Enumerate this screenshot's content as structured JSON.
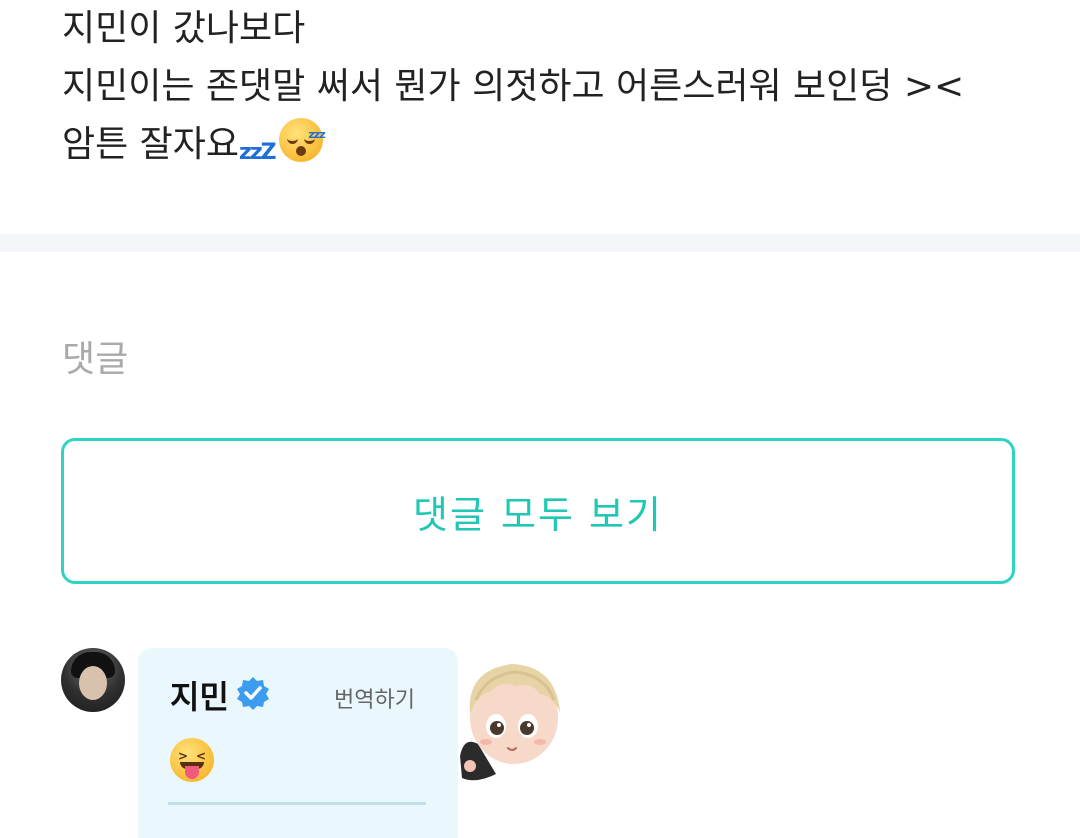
{
  "post": {
    "lines": [
      "지민이 갔나보다",
      "지민이는 존댓말 써서 뭔가 의젓하고 어른스러워 보인덩 ><",
      "암튼 잘자요"
    ],
    "emoji_zzz": "💤",
    "emoji_sleepy": "😴"
  },
  "comments": {
    "heading": "댓글",
    "view_all_label": "댓글 모두 보기",
    "items": [
      {
        "author": "지민",
        "translate_label": "번역하기",
        "emoji": "😝"
      }
    ]
  },
  "colors": {
    "accent": "#2dd4c3",
    "accent_text": "#1fc7b4",
    "verified": "#3b9cf0",
    "card_bg": "#eaf7fd",
    "divider": "#f3f5f9"
  },
  "icons": {
    "verified": "verified-badge-icon",
    "zzz": "zzz-icon",
    "sleepy": "sleepy-face-icon",
    "tongue": "squinting-tongue-face-icon",
    "sticker": "chibi-character-sticker"
  }
}
